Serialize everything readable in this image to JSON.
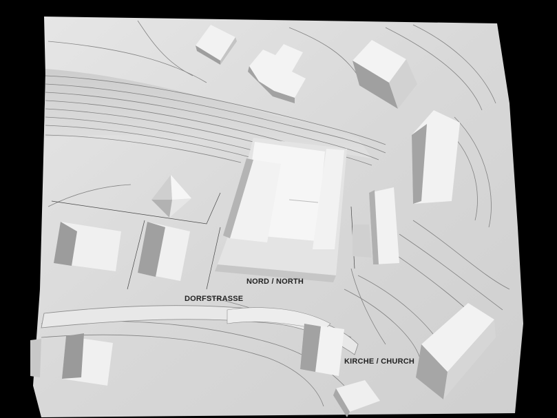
{
  "labels": {
    "north": "NORD / NORTH",
    "street": "DORFSTRASSE",
    "church": "KIRCHE / CHURCH"
  },
  "colors": {
    "background": "#000000",
    "model_base": "#dcdcdc",
    "building_top": "#f4f4f4",
    "building_shade": "#a8a8a8",
    "contour_line": "#555555",
    "label_text": "#222222"
  }
}
